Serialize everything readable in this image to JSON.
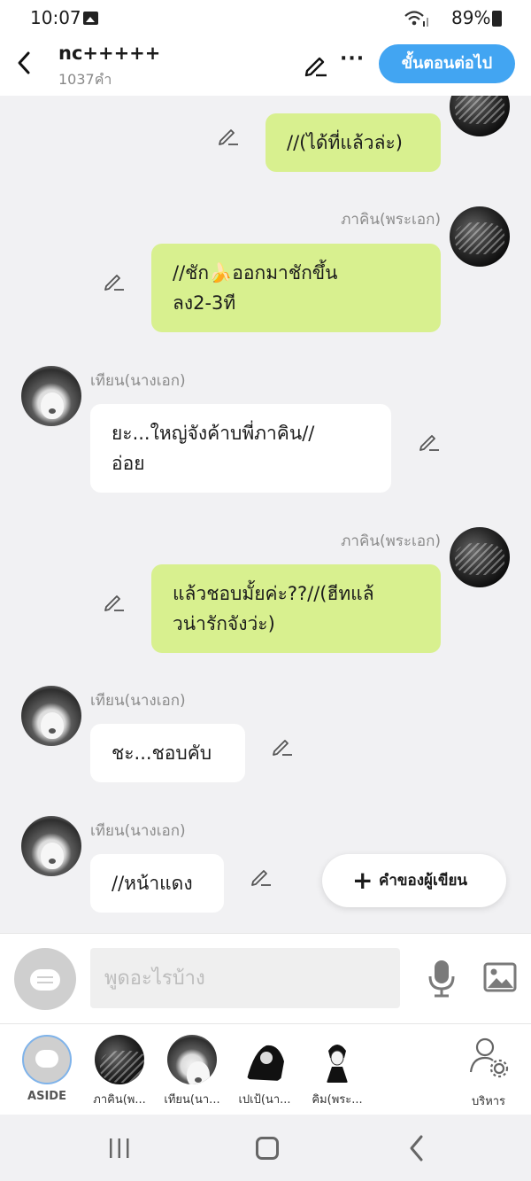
{
  "status_bar": {
    "time": "10:07",
    "battery": "89%"
  },
  "header": {
    "title": "nc+++++",
    "word_count": "1037คำ",
    "next_button": "ขั้นตอนต่อไป"
  },
  "messages": [
    {
      "side": "right",
      "speaker": "",
      "text_lines": [
        "//(ได้ที่แล้วล่ะ)"
      ]
    },
    {
      "side": "right",
      "speaker": "ภาคิน(พระเอก)",
      "text_lines": [
        "//ชัก🍌ออกมาชักขึ้น",
        "ลง2-3ที"
      ]
    },
    {
      "side": "left",
      "speaker": "เทียน(นางเอก)",
      "text_lines": [
        "ยะ...ใหญ่จังค้าบพี่ภาคิน//",
        "อ่อย"
      ]
    },
    {
      "side": "right",
      "speaker": "ภาคิน(พระเอก)",
      "text_lines": [
        "แล้วชอบมั้ยค่ะ??//(ฮีทแล้",
        "วน่ารักจังว่ะ)"
      ]
    },
    {
      "side": "left",
      "speaker": "เทียน(นางเอก)",
      "text_lines": [
        "ชะ...ชอบคับ"
      ]
    },
    {
      "side": "left",
      "speaker": "เทียน(นางเอก)",
      "text_lines": [
        "//หน้าแดง"
      ]
    }
  ],
  "fab": {
    "label": "คำของผู้เขียน"
  },
  "composer": {
    "placeholder": "พูดอะไรบ้าง"
  },
  "characters": {
    "aside_label": "ASIDE",
    "items": [
      "ภาคิน(พ...",
      "เทียน(นา...",
      "เปเป้(นา...",
      "คิม(พระ..."
    ],
    "manage_label": "บริหาร"
  },
  "colors": {
    "accent": "#42a5f2",
    "green_bubble": "#d8f08f",
    "white_bubble": "#ffffff",
    "background": "#f1f1f3"
  }
}
